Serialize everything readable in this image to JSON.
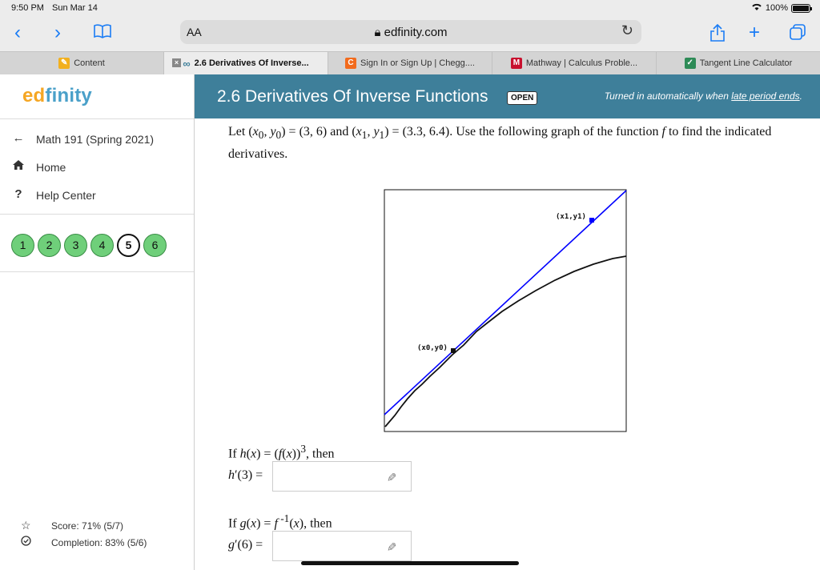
{
  "status": {
    "time": "9:50 PM",
    "date": "Sun Mar 14",
    "battery": "100%"
  },
  "browser": {
    "text_size_label": "AA",
    "url": "edfinity.com"
  },
  "tabs": [
    {
      "label": "Content",
      "icon": "pencil-favicon",
      "active": false
    },
    {
      "label": "2.6 Derivatives Of Inverse...",
      "icon": "edfinity-favicon",
      "active": true
    },
    {
      "label": "Sign In or Sign Up | Chegg....",
      "icon": "chegg-favicon",
      "active": false
    },
    {
      "label": "Mathway | Calculus Proble...",
      "icon": "mathway-favicon",
      "active": false
    },
    {
      "label": "Tangent Line Calculator",
      "icon": "symbolab-favicon",
      "active": false
    }
  ],
  "sidebar": {
    "logo": {
      "ed": "ed",
      "rest": "finity"
    },
    "back": "Math 191 (Spring 2021)",
    "home": "Home",
    "help": "Help Center",
    "problems": [
      "1",
      "2",
      "3",
      "4",
      "5",
      "6"
    ],
    "current_problem": "5",
    "score": "Score: 71% (5/7)",
    "completion": "Completion: 83% (5/6)"
  },
  "header": {
    "title": "2.6 Derivatives Of Inverse Functions",
    "badge": "OPEN",
    "turnin_prefix": "Turned in automatically when ",
    "turnin_link": "late period ends",
    "turnin_suffix": "."
  },
  "problem": {
    "graph_point0_label": "(x0,y0)",
    "graph_point1_label": "(x1,y1)"
  },
  "colors": {
    "header": "#3e7f9a",
    "accent": "#1a7cf5",
    "green": "#6fcf7a",
    "tangent": "#0000ff"
  }
}
